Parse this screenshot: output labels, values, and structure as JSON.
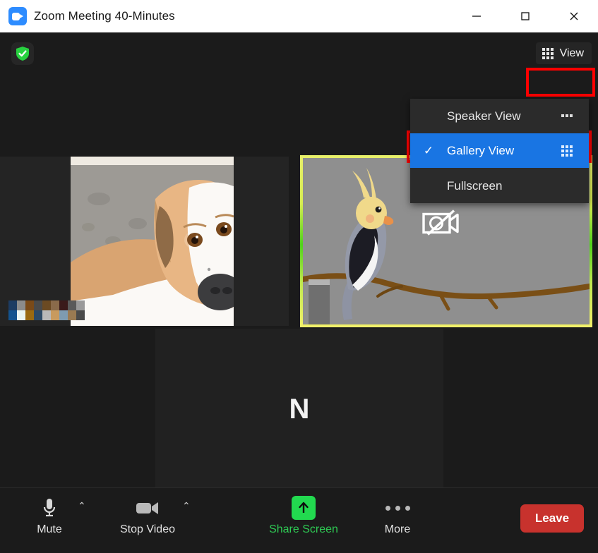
{
  "window": {
    "title": "Zoom Meeting 40-Minutes",
    "app_icon": "zoom-camera-icon",
    "controls": {
      "minimize": "minimize-icon",
      "maximize": "maximize-icon",
      "close": "close-icon"
    }
  },
  "meeting": {
    "encryption_badge": "green-shield-check-icon",
    "view_button": {
      "label": "View",
      "icon": "grid-3x3-icon"
    },
    "view_menu": {
      "items": [
        {
          "label": "Speaker View",
          "icon": "speaker-view-icon",
          "checked": "",
          "selected": false
        },
        {
          "label": "Gallery View",
          "icon": "gallery-view-grid-icon",
          "checked": "✓",
          "selected": true
        },
        {
          "label": "Fullscreen",
          "icon": "",
          "checked": "",
          "selected": false
        }
      ]
    },
    "tiles": [
      {
        "id": "dog",
        "type": "video",
        "content": "dog-photo",
        "name_label": "blurred-participant-name",
        "active_speaker": false
      },
      {
        "id": "bird",
        "type": "virtual-background",
        "content": "cockatiel-illustration",
        "status_icon": "camera-off-icon",
        "active_speaker": true,
        "border_color": "#c9e65a"
      },
      {
        "id": "initial",
        "type": "avatar",
        "initial": "N",
        "active_speaker": false
      }
    ]
  },
  "toolbar": {
    "mute": {
      "label": "Mute",
      "icon": "microphone-icon",
      "caret": "⌃"
    },
    "video": {
      "label": "Stop Video",
      "icon": "video-camera-icon",
      "caret": "⌃"
    },
    "share": {
      "label": "Share Screen",
      "icon": "share-screen-arrow-icon",
      "color": "#2ecc54"
    },
    "more": {
      "label": "More",
      "icon": "ellipsis-icon"
    },
    "leave": {
      "label": "Leave",
      "color": "#c8322d"
    }
  },
  "annotations": [
    {
      "target": "view-button",
      "color": "#ff0000"
    },
    {
      "target": "gallery-view-menu-item",
      "color": "#ff0000"
    }
  ]
}
